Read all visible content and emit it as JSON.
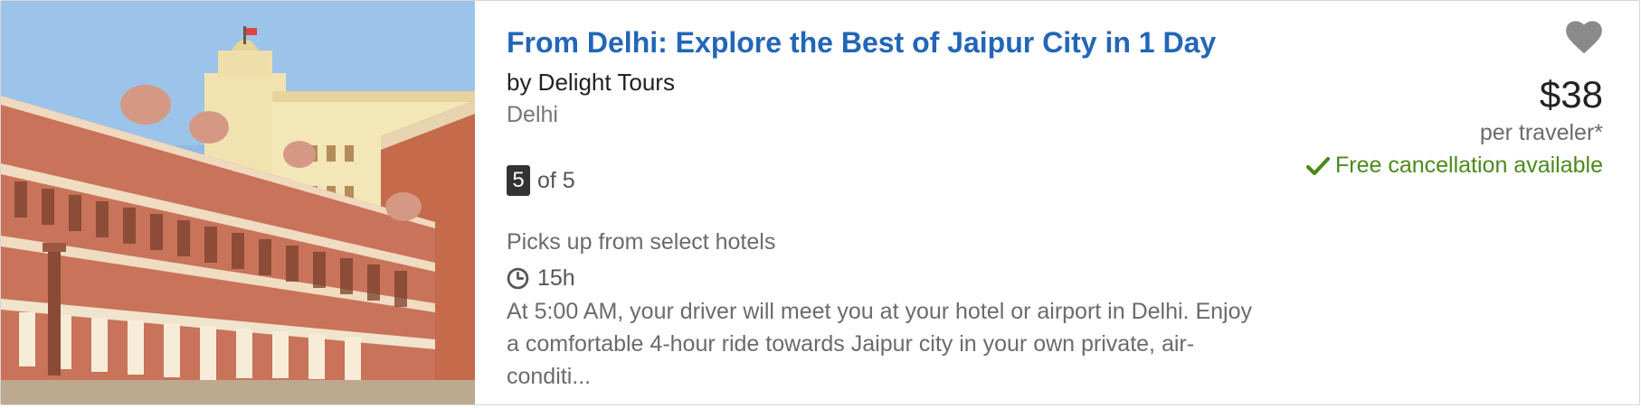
{
  "listing": {
    "title": "From Delhi: Explore the Best of Jaipur City in 1 Day",
    "supplier": "by Delight Tours",
    "location": "Delhi",
    "rating": {
      "value": "5",
      "suffix": "of 5"
    },
    "pickup": "Picks up from select hotels",
    "duration": "15h",
    "description": "At 5:00 AM, your driver will meet you at your hotel or airport in Delhi. Enjoy a comfortable 4-hour ride towards Jaipur city in your own private, air-conditi...",
    "price": "$38",
    "price_unit": "per traveler*",
    "cancellation": "Free cancellation available"
  },
  "icons": {
    "wishlist": "heart-icon",
    "duration": "clock-icon",
    "cancellation": "checkmark-icon"
  },
  "colors": {
    "title": "#2266b8",
    "cancellation": "#4a8a1c",
    "rating_badge": "#333333",
    "heart": "#8a8a8a"
  }
}
